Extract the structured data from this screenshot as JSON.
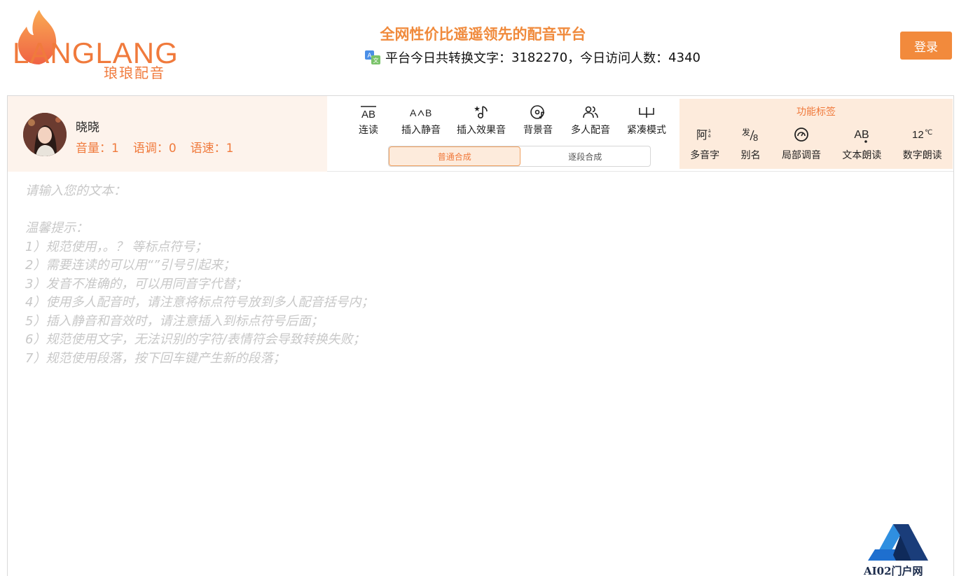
{
  "header": {
    "logo_text": "LANGLANG",
    "logo_subtitle": "琅琅配音",
    "slogan": "全网性价比遥遥领先的配音平台",
    "stats_label": "平台今日共转换文字：",
    "stats_chars": "3182270",
    "stats_sep": "，今日访问人数：",
    "stats_visitors": "4340",
    "login_label": "登录"
  },
  "voice": {
    "name": "晓晓",
    "volume": "音量：1",
    "pitch": "语调：0",
    "speed": "语速：1"
  },
  "tools": [
    {
      "label": "连读",
      "icon": "liaison-icon"
    },
    {
      "label": "插入静音",
      "icon": "silence-icon"
    },
    {
      "label": "插入效果音",
      "icon": "sound-effect-icon"
    },
    {
      "label": "背景音",
      "icon": "background-music-icon"
    },
    {
      "label": "多人配音",
      "icon": "multi-voice-icon"
    },
    {
      "label": "紧凑模式",
      "icon": "compact-mode-icon"
    }
  ],
  "modes": {
    "normal": "普通合成",
    "segment": "逐段合成",
    "active": "normal"
  },
  "functions": {
    "title": "功能标签",
    "items": [
      {
        "label": "多音字",
        "icon": "polyphone-icon"
      },
      {
        "label": "别名",
        "icon": "alias-icon"
      },
      {
        "label": "局部调音",
        "icon": "local-tune-icon"
      },
      {
        "label": "文本朗读",
        "icon": "text-read-icon"
      },
      {
        "label": "数字朗读",
        "icon": "number-read-icon"
      }
    ]
  },
  "editor": {
    "placeholder": "请输入您的文本：\n\n温馨提示：\n1）规范使用，。？ 等标点符号；\n2）需要连读的可以用“”引号引起来；\n3）发音不准确的，可以用同音字代替；\n4）使用多人配音时，请注意将标点符号放到多人配音括号内；\n5）插入静音和音效时，请注意插入到标点符号后面；\n6）规范使用文字，无法识别的字符/表情符会导致转换失败；\n7）规范使用段落，按下回车键产生新的段落；",
    "value": ""
  },
  "watermark": {
    "text": "AI02门户网"
  },
  "colors": {
    "accent": "#f07a3c",
    "button": "#f28a3c",
    "panel_tint": "#fdf3ec",
    "func_tint": "#fdebdc"
  }
}
